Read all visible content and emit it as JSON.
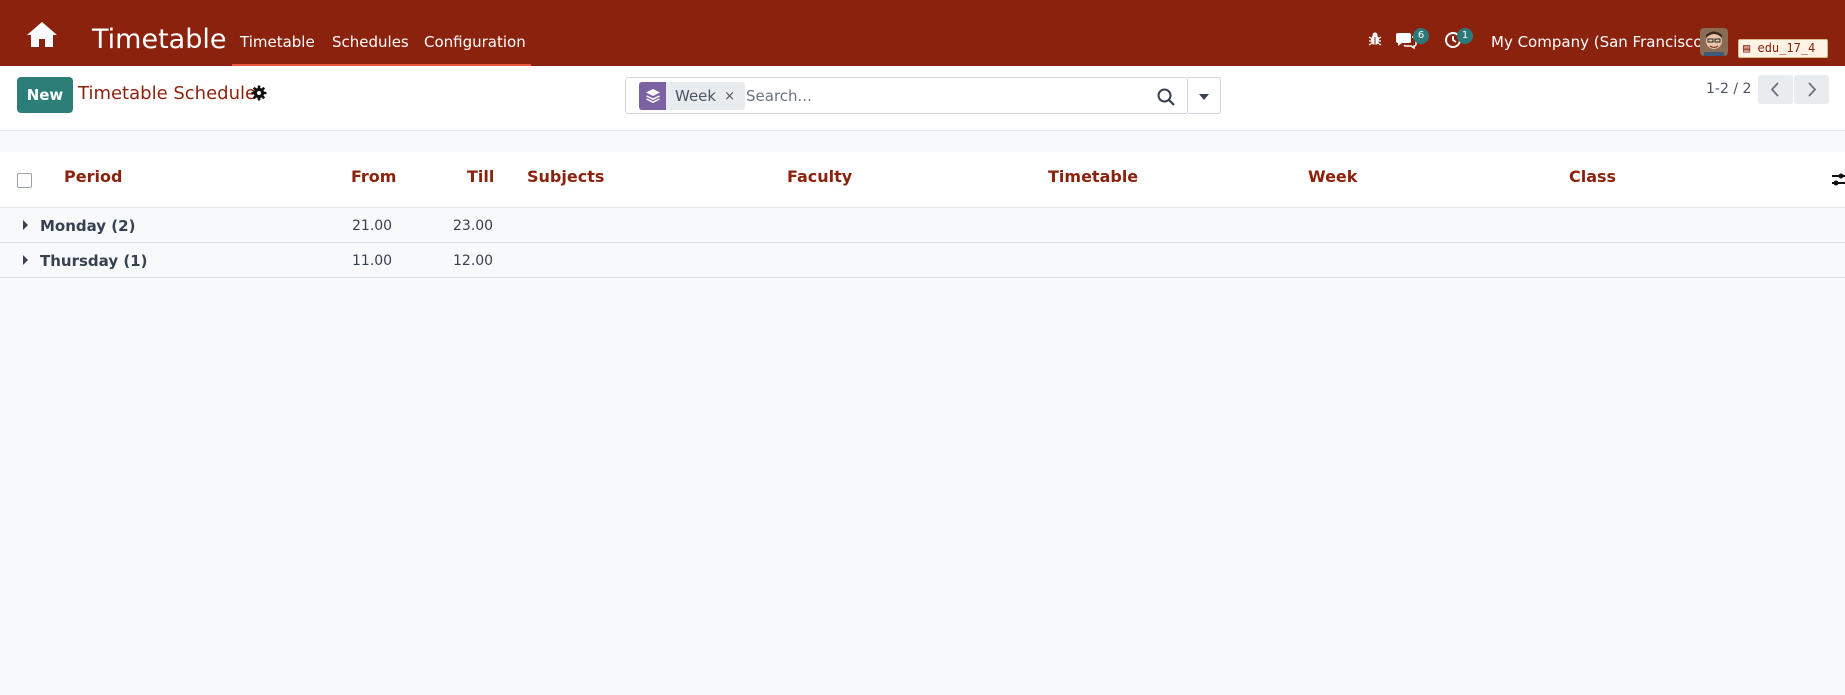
{
  "navbar": {
    "app_title": "Timetable",
    "menu": [
      "Timetable",
      "Schedules",
      "Configuration"
    ],
    "messages_count": "6",
    "activities_count": "1",
    "company": "My Company (San Francisco)",
    "db_name": "edu_17_4"
  },
  "control": {
    "new_label": "New",
    "breadcrumb": "Timetable Schedule",
    "facet_label": "Week",
    "facet_remove": "×",
    "search_placeholder": "Search...",
    "pager": "1-2 / 2"
  },
  "table": {
    "columns": [
      "Period",
      "From",
      "Till",
      "Subjects",
      "Faculty",
      "Timetable",
      "Week",
      "Class"
    ],
    "groups": [
      {
        "label": "Monday (2)",
        "from": "21.00",
        "till": "23.00"
      },
      {
        "label": "Thursday (1)",
        "from": "11.00",
        "till": "12.00"
      }
    ]
  },
  "colors": {
    "brand": "#8b220e",
    "primary_button": "#2d7d78",
    "facet_icon": "#7b62a3"
  }
}
